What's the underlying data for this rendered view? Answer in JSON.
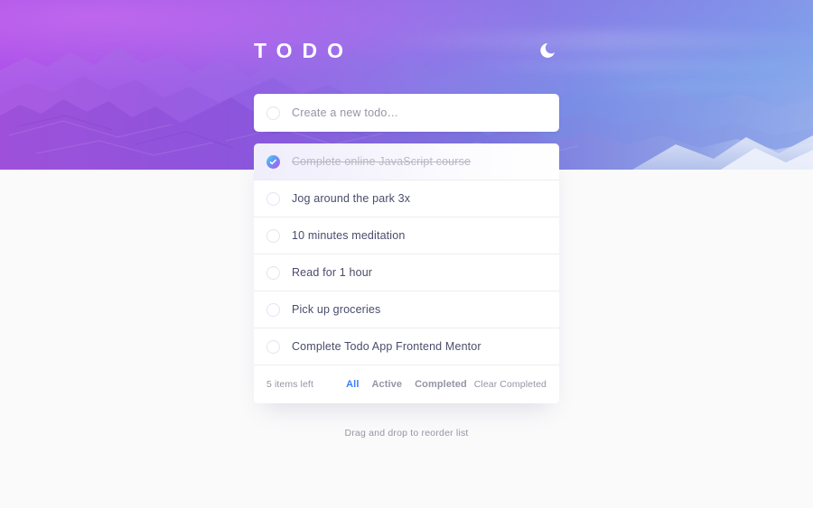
{
  "header": {
    "app_title": "TODO",
    "theme_toggle_icon": "moon-icon",
    "background_image": "mountain-landscape-photo"
  },
  "new_todo": {
    "placeholder": "Create a new todo…",
    "value": "",
    "checkbox_icon": "circle-outline-icon"
  },
  "todos": [
    {
      "label": "Complete online JavaScript course",
      "completed": true,
      "highlighted": true
    },
    {
      "label": "Jog around the park 3x",
      "completed": false,
      "highlighted": false
    },
    {
      "label": "10 minutes meditation",
      "completed": false,
      "highlighted": false
    },
    {
      "label": "Read for 1 hour",
      "completed": false,
      "highlighted": false
    },
    {
      "label": "Pick up groceries",
      "completed": false,
      "highlighted": false
    },
    {
      "label": "Complete Todo App Frontend Mentor",
      "completed": false,
      "highlighted": false
    }
  ],
  "footer": {
    "items_left": "5 items left",
    "filters": [
      {
        "label": "All",
        "active": true
      },
      {
        "label": "Active",
        "active": false
      },
      {
        "label": "Completed",
        "active": false
      }
    ],
    "clear_completed": "Clear Completed"
  },
  "hint": "Drag and drop to reorder list",
  "colors": {
    "accent_blue": "#3a7cfd",
    "text_primary": "#494c6b",
    "text_muted": "#9495a5",
    "text_completed": "#b7b8c4",
    "page_background": "#fafafa",
    "card_background": "#ffffff",
    "check_gradient_from": "#57ddff",
    "check_gradient_to": "#c058f3"
  }
}
